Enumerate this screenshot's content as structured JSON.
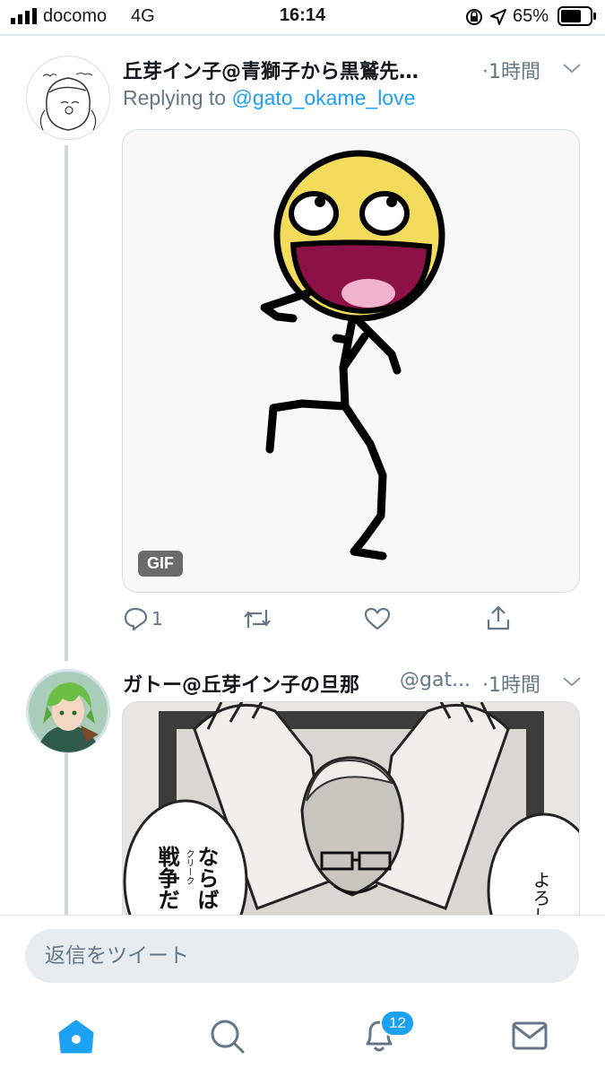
{
  "status_bar": {
    "carrier": "docomo",
    "network": "4G",
    "time": "16:14",
    "battery": "65%"
  },
  "tweets": [
    {
      "author": "丘芽イン子@青獅子から黒鷲先…",
      "time": "·1時間",
      "replying_prefix": "Replying to",
      "replying_handle": "@gato_okame_love",
      "media_badge": "GIF",
      "reply_count": "1"
    },
    {
      "author": "ガトー@丘芽イン子の旦那",
      "handle": "@gat...",
      "time": "·1時間",
      "manga_text_1": "ならば",
      "manga_text_2": "戦争だ",
      "manga_ruby": "クリーク",
      "manga_text_3": "よろし"
    }
  ],
  "composer": {
    "placeholder": "返信をツイート"
  },
  "tab_bar": {
    "notifications_count": "12"
  },
  "colors": {
    "accent": "#1da1f2",
    "secondary_text": "#657786"
  },
  "icons": [
    "signal-icon",
    "location-icon",
    "lock-rotation-icon",
    "battery-icon",
    "chevron-down-icon",
    "reply-icon",
    "retweet-icon",
    "like-icon",
    "share-icon",
    "home-icon",
    "search-icon",
    "bell-icon",
    "mail-icon"
  ]
}
